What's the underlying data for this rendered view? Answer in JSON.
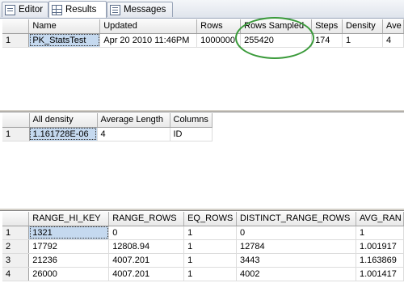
{
  "tabs": [
    {
      "label": "Editor",
      "icon": "editor-icon"
    },
    {
      "label": "Results",
      "icon": "grid-icon",
      "active": true
    },
    {
      "label": "Messages",
      "icon": "messages-icon"
    }
  ],
  "grid1": {
    "columns": [
      "",
      "Name",
      "Updated",
      "Rows",
      "Rows Sampled",
      "Steps",
      "Density",
      "Ave"
    ],
    "rows": [
      [
        "1",
        "PK_StatsTest",
        "Apr 20 2010 11:46PM",
        "1000000",
        "255420",
        "174",
        "1",
        "4"
      ]
    ]
  },
  "grid2": {
    "columns": [
      "",
      "All density",
      "Average Length",
      "Columns"
    ],
    "rows": [
      [
        "1",
        "1.161728E-06",
        "4",
        "ID"
      ]
    ]
  },
  "grid3": {
    "columns": [
      "",
      "RANGE_HI_KEY",
      "RANGE_ROWS",
      "EQ_ROWS",
      "DISTINCT_RANGE_ROWS",
      "AVG_RAN"
    ],
    "rows": [
      [
        "1",
        "1321",
        "0",
        "1",
        "0",
        "1"
      ],
      [
        "2",
        "17792",
        "12808.94",
        "1",
        "12784",
        "1.001917"
      ],
      [
        "3",
        "21236",
        "4007.201",
        "1",
        "3443",
        "1.163869"
      ],
      [
        "4",
        "26000",
        "4007.201",
        "1",
        "4002",
        "1.001417"
      ]
    ]
  },
  "colors": {
    "highlight_circle": "#3a9a3a",
    "selected_cell": "#c5d9ef"
  }
}
